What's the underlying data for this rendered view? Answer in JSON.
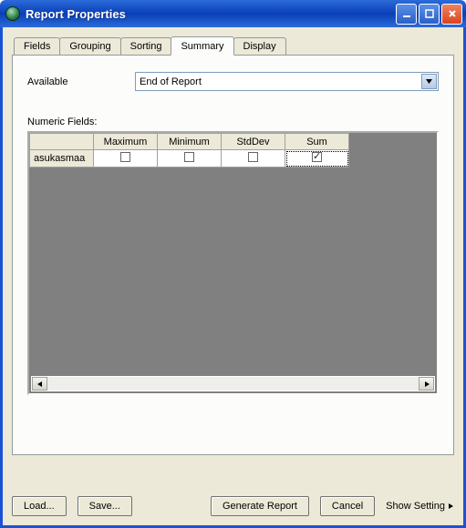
{
  "window": {
    "title": "Report Properties"
  },
  "tabs": {
    "fields": "Fields",
    "grouping": "Grouping",
    "sorting": "Sorting",
    "summary": "Summary",
    "display": "Display"
  },
  "panel": {
    "available_label": "Available",
    "dropdown_value": "End of Report",
    "numeric_fields_label": "Numeric Fields:",
    "columns": {
      "maximum": "Maximum",
      "minimum": "Minimum",
      "stddev": "StdDev",
      "sum": "Sum"
    },
    "rows": [
      {
        "name": "asukasmaa",
        "maximum": false,
        "minimum": false,
        "stddev": false,
        "sum": true
      }
    ]
  },
  "buttons": {
    "load": "Load...",
    "save": "Save...",
    "generate": "Generate Report",
    "cancel": "Cancel",
    "show_settings": "Show Setting"
  }
}
